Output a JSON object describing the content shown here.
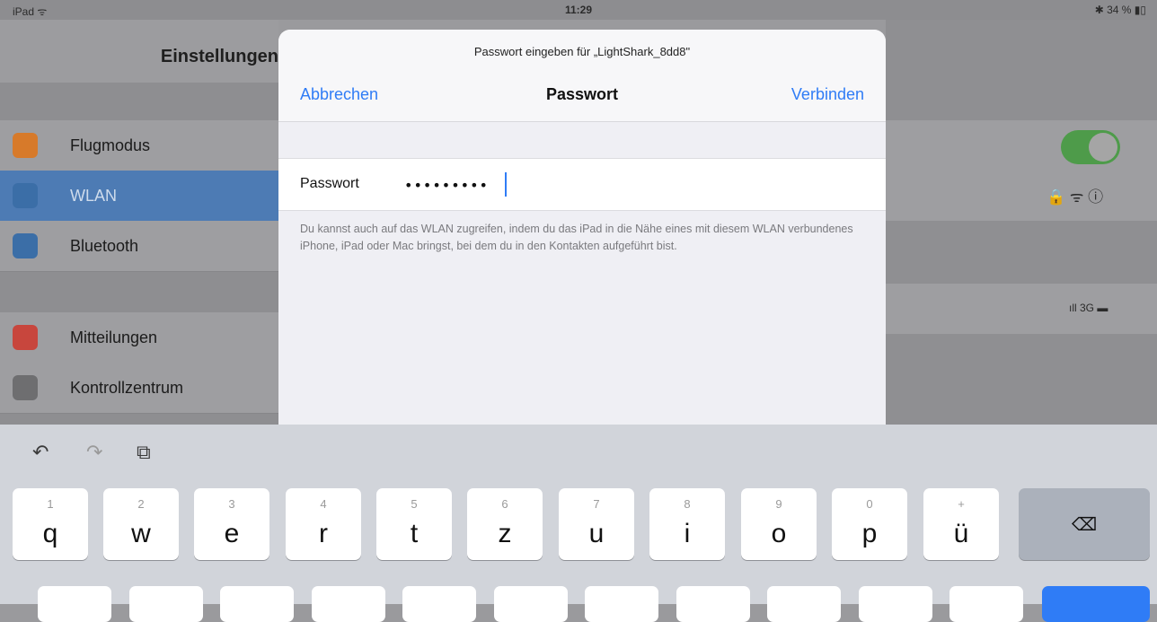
{
  "status_bar": {
    "device": "iPad ᯤ",
    "time": "11:29",
    "battery": "✱ 34 % ▮▯"
  },
  "settings": {
    "title": "Einstellungen",
    "rows": [
      {
        "label": "Flugmodus",
        "icon": "airplane-icon",
        "color": "#d77a2a"
      },
      {
        "label": "WLAN",
        "icon": "wifi-icon",
        "color": "#3b6ea7"
      },
      {
        "label": "Bluetooth",
        "icon": "bluetooth-icon",
        "color": "#3b6ea7"
      },
      {
        "label": "Mitteilungen",
        "icon": "notifications-icon",
        "color": "#c8463d"
      },
      {
        "label": "Kontrollzentrum",
        "icon": "control-center-icon",
        "color": "#6e6e70"
      }
    ],
    "wifi_status": "🔒 ᯤ ⓘ",
    "cellular_status": "ıll 3G ▬"
  },
  "modal": {
    "prompt": "Passwort eingeben für „LightShark_8dd8\"",
    "cancel": "Abbrechen",
    "title": "Passwort",
    "connect": "Verbinden",
    "password_label": "Passwort",
    "password_value": "•••••••••",
    "hint": "Du kannst auch auf das WLAN zugreifen, indem du das iPad in die Nähe eines mit diesem WLAN verbundenes iPhone, iPad oder Mac bringst, bei dem du in den Kontakten aufgeführt bist."
  },
  "keyboard": {
    "undo": "↶",
    "redo": "↷",
    "paste": "⧉",
    "keys": [
      {
        "num": "1",
        "ch": "q"
      },
      {
        "num": "2",
        "ch": "w"
      },
      {
        "num": "3",
        "ch": "e"
      },
      {
        "num": "4",
        "ch": "r"
      },
      {
        "num": "5",
        "ch": "t"
      },
      {
        "num": "6",
        "ch": "z"
      },
      {
        "num": "7",
        "ch": "u"
      },
      {
        "num": "8",
        "ch": "i"
      },
      {
        "num": "9",
        "ch": "o"
      },
      {
        "num": "0",
        "ch": "p"
      },
      {
        "num": "+",
        "ch": "ü"
      }
    ],
    "backspace": "⌫"
  }
}
